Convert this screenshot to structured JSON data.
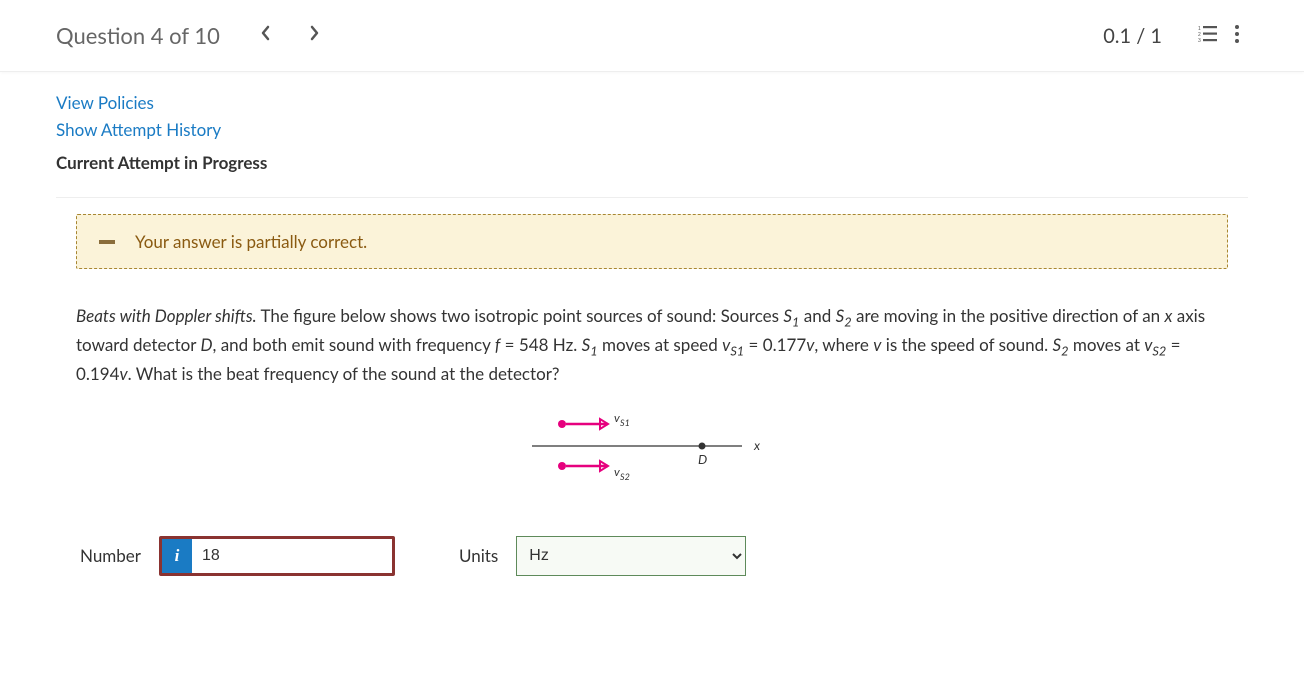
{
  "header": {
    "title": "Question 4 of 10",
    "score": "0.1 / 1"
  },
  "links": {
    "policies": "View Policies",
    "history": "Show Attempt History"
  },
  "status": {
    "current": "Current Attempt in Progress",
    "feedback": "Your answer is partially correct."
  },
  "problem": {
    "lead": "Beats with Doppler shifts.",
    "text_a": " The figure below shows two isotropic point sources of sound: Sources ",
    "s1": "S",
    "s1sub": "1",
    "text_b": " and ",
    "s2": "S",
    "s2sub": "2",
    "text_c": " are moving in the positive direction of an ",
    "xaxis": "x",
    "text_d": " axis toward detector ",
    "D": "D",
    "text_e": ", and both emit sound with frequency ",
    "fvar": "f",
    "text_f": " = 548 Hz. ",
    "s1b": "S",
    "s1bsub": "1",
    "text_g": " moves at speed ",
    "vs1": "v",
    "vs1sub": "S1",
    "text_h": " = 0.177",
    "v1": "v",
    "text_i": ", where ",
    "v2": "v",
    "text_j": " is the speed of sound. ",
    "s2b": "S",
    "s2bsub": "2",
    "text_k": " moves at ",
    "vs2": "v",
    "vs2sub": "S2",
    "text_l": " = 0.194",
    "v3": "v",
    "text_m": ". What is the beat frequency of the sound at the detector?"
  },
  "figure": {
    "vs1": "vS1",
    "vs2": "vS2",
    "D": "D",
    "x": "x"
  },
  "answer": {
    "number_label": "Number",
    "info": "i",
    "value": "18",
    "units_label": "Units",
    "units_value": "Hz"
  }
}
